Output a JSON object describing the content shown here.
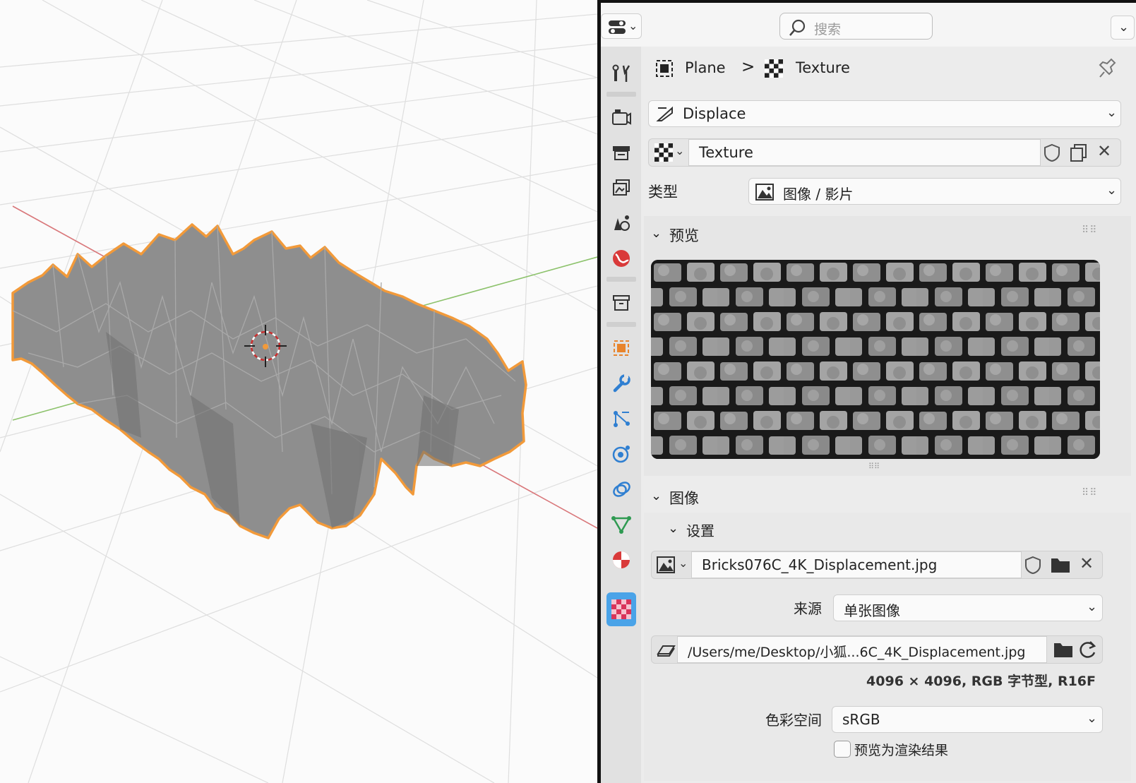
{
  "search": {
    "placeholder": "搜索"
  },
  "breadcrumb": {
    "object": "Plane",
    "separator": ">",
    "texture": "Texture"
  },
  "modifier": {
    "name": "Displace"
  },
  "texture_block": {
    "name": "Texture"
  },
  "type_row": {
    "label": "类型",
    "value": "图像 / 影片"
  },
  "preview_section": {
    "title": "预览"
  },
  "image_section": {
    "title": "图像"
  },
  "settings_section": {
    "title": "设置"
  },
  "image_block": {
    "name": "Bricks076C_4K_Displacement.jpg"
  },
  "source_row": {
    "label": "来源",
    "value": "单张图像"
  },
  "filepath": {
    "value": "/Users/me/Desktop/小狐...6C_4K_Displacement.jpg"
  },
  "image_info": "4096 × 4096,  RGB 字节型, R16F",
  "colorspace_row": {
    "label": "色彩空间",
    "value": "sRGB"
  },
  "preview_render_checkbox": {
    "label": "预览为渲染结果",
    "checked": false
  },
  "colors": {
    "accent": "#4aa3e8",
    "selection_outline": "#f29a3a",
    "mesh": "#8e8e8e",
    "x_axis": "#d9777a",
    "y_axis": "#8cc26b"
  }
}
